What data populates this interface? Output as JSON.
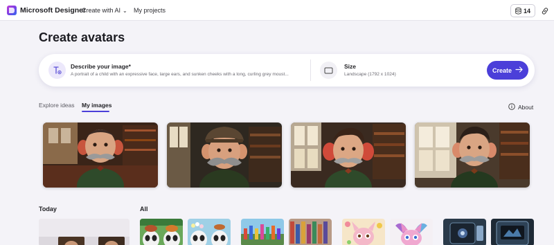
{
  "nav": {
    "brand": "Microsoft Designer",
    "create_with_ai": "Create with AI",
    "my_projects": "My projects",
    "credits": "14",
    "accent_color": "#4b3fd9"
  },
  "page": {
    "title": "Create avatars"
  },
  "prompt": {
    "describe_label": "Describe your image*",
    "describe_text": "A portrait of a child with an expressive face, large ears, and sunken cheeks with a long, curling grey moust...",
    "size_label": "Size",
    "size_value": "Landscape (1792 x 1024)",
    "create_label": "Create"
  },
  "tabs": {
    "explore": "Explore ideas",
    "my_images": "My images",
    "about": "About"
  },
  "sections": {
    "today": "Today",
    "all": "All"
  },
  "icons": {
    "logo": "designer-logo-icon",
    "chevron": "chevron-down-icon",
    "credits": "coin-stack-icon",
    "share": "link-icon",
    "prompt": "text-prompt-icon",
    "size": "aspect-ratio-icon",
    "create_arrow": "arrow-right-icon",
    "about": "info-icon"
  }
}
